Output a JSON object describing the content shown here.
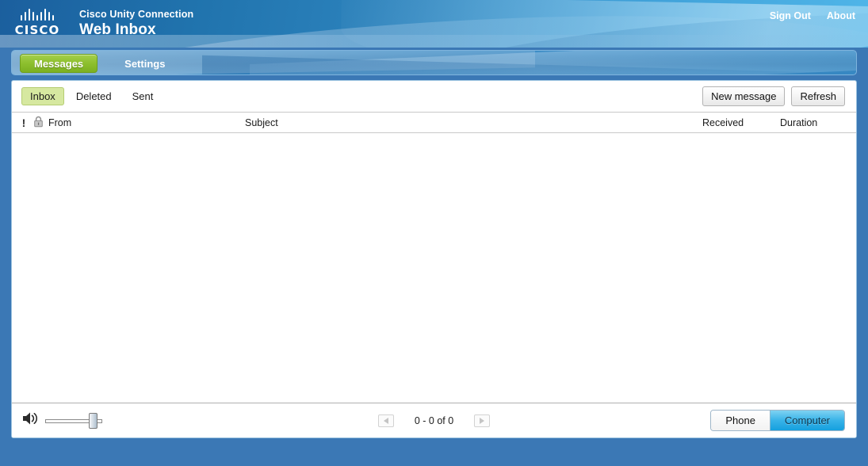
{
  "header": {
    "logo_name": "cisco-logo",
    "logo_word": "CISCO",
    "product_line1": "Cisco Unity Connection",
    "product_line2": "Web Inbox",
    "links": [
      {
        "label": "Sign Out",
        "name": "sign-out-link"
      },
      {
        "label": "About",
        "name": "about-link"
      }
    ]
  },
  "nav": {
    "tabs": [
      {
        "label": "Messages",
        "name": "tab-messages",
        "active": true
      },
      {
        "label": "Settings",
        "name": "tab-settings",
        "active": false
      }
    ]
  },
  "toolbar": {
    "folders": [
      {
        "label": "Inbox",
        "name": "folder-inbox",
        "active": true
      },
      {
        "label": "Deleted",
        "name": "folder-deleted",
        "active": false
      },
      {
        "label": "Sent",
        "name": "folder-sent",
        "active": false
      }
    ],
    "new_message_label": "New message",
    "refresh_label": "Refresh"
  },
  "message_list": {
    "columns": [
      {
        "label": "!",
        "name": "column-urgent",
        "icon": "exclamation-icon"
      },
      {
        "label": "",
        "name": "column-secure",
        "icon": "lock-icon"
      },
      {
        "label": "From",
        "name": "column-from"
      },
      {
        "label": "Subject",
        "name": "column-subject"
      },
      {
        "label": "Received",
        "name": "column-received"
      },
      {
        "label": "Duration",
        "name": "column-duration"
      }
    ],
    "rows": [],
    "empty": true
  },
  "footer": {
    "volume": {
      "icon": "speaker-icon",
      "level_percent": 78
    },
    "pager": {
      "prev_label": "",
      "next_label": "",
      "count_label": "0 - 0 of 0",
      "prev_enabled": false,
      "next_enabled": false
    },
    "playback": {
      "options": [
        {
          "label": "Phone",
          "name": "playback-phone",
          "selected": false
        },
        {
          "label": "Computer",
          "name": "playback-computer",
          "selected": true
        }
      ]
    }
  },
  "colors": {
    "page_background": "#3b78b5",
    "header_blue_dark": "#1b5f9e",
    "header_blue_light": "#4fb5e8",
    "tab_active_green": "#8dbf2e",
    "folder_active_green": "#d6e8a0",
    "playback_selected_blue": "#38b3e8",
    "panel_border": "#9cc3e0"
  }
}
